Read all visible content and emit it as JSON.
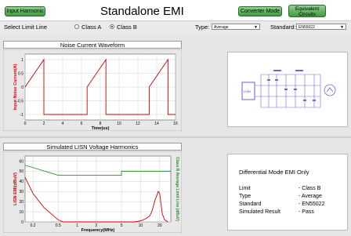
{
  "header": {
    "input_harmonic_label": "Input Harmonic",
    "title": "Standalone EMI",
    "converter_mode_label": "Converter Mode",
    "equivalent_circuits_label": "Equivalent\nCircuits"
  },
  "toolbar": {
    "select_limit_label": "Select Limit Line",
    "class_a": "Class A",
    "class_b": "Class B",
    "selected_class": "Class B",
    "type_label": "Type:",
    "type_value": "Average",
    "standard_label": "Standard:",
    "standard_value": "EN55022"
  },
  "top_panel": {
    "title": "Noise Current Waveform"
  },
  "bottom_panel": {
    "title": "Simulated LISN Voltage Harmonics"
  },
  "circuit": {
    "lisn_label": "LISN"
  },
  "result": {
    "heading": "Differential Mode EMI Only",
    "rows": [
      {
        "label": "Limit",
        "value": "- Class B"
      },
      {
        "label": "Type",
        "value": "- Average"
      },
      {
        "label": "Standard",
        "value": "- EN55022"
      },
      {
        "label": "Simulated Result",
        "value": "- Pass"
      }
    ]
  },
  "colors": {
    "button_green": "#5fb85f",
    "plot_bg": "#ffffff",
    "noise_trace": "#cc0000",
    "limit_line": "#2e8b2e",
    "axis_label_red": "#cc0000",
    "axis_label_green": "#2e8b2e"
  },
  "chart_data": [
    {
      "type": "line",
      "title": "Noise Current Waveform",
      "xlabel": "Time(us)",
      "ylabel": "Input Noise Current(A)",
      "xlim": [
        0,
        16
      ],
      "ylim": [
        -1.2,
        1.2
      ],
      "xticks": [
        0,
        2,
        4,
        6,
        8,
        10,
        12,
        14,
        16
      ],
      "yticks": [
        -1,
        -0.5,
        0,
        0.5,
        1
      ],
      "grid": true,
      "series": [
        {
          "x": [
            0,
            2,
            2,
            6.6,
            6.6,
            8.6,
            8.6,
            13.2,
            13.2,
            15.2,
            15.2,
            16
          ],
          "values": [
            0,
            1,
            -1,
            -1,
            0,
            1,
            -1,
            -1,
            0,
            1,
            -1,
            -1
          ]
        }
      ]
    },
    {
      "type": "line",
      "title": "Simulated LISN Voltage Harmonics",
      "xlabel": "Frequency(MHz)",
      "ylabel": "LISN EMI(dBuV)",
      "ylabel_right": "Class B Average Limit Line (dBuV)",
      "xscale": "log",
      "xlim": [
        0.15,
        30
      ],
      "ylim": [
        0,
        65
      ],
      "xticks": [
        0.2,
        0.5,
        1,
        2,
        5,
        10,
        20
      ],
      "yticks": [
        0,
        10,
        20,
        30,
        40,
        50,
        60
      ],
      "grid": true,
      "series": [
        {
          "name": "limit",
          "x": [
            0.15,
            0.5,
            0.5,
            5,
            5,
            30
          ],
          "values": [
            56,
            46,
            46,
            46,
            50,
            50
          ]
        },
        {
          "name": "emi",
          "x": [
            0.15,
            0.2,
            0.3,
            0.5,
            0.6,
            1,
            2,
            5,
            8,
            10,
            12,
            14,
            15,
            16,
            17,
            18,
            19,
            20,
            21,
            22,
            24,
            27
          ],
          "values": [
            44,
            28,
            14,
            2,
            0,
            0,
            0,
            0,
            0,
            1,
            3,
            6,
            10,
            16,
            22,
            26,
            30,
            28,
            18,
            8,
            2,
            0
          ]
        }
      ]
    }
  ]
}
